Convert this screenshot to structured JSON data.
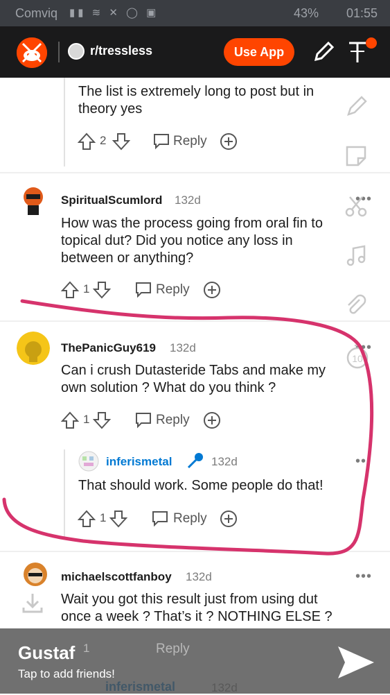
{
  "status_bar": {
    "carrier": "Comviq",
    "battery": "43%",
    "time": "01:55"
  },
  "header": {
    "subreddit": "r/tressless",
    "use_app_label": "Use App"
  },
  "comments": [
    {
      "text_lines": [
        "The list is extremely long to post but in",
        "theory yes"
      ],
      "votes": "2",
      "reply_label": "Reply"
    },
    {
      "author": "SpiritualScumlord",
      "age": "132d",
      "text_lines": [
        "How was the process going from oral fin to",
        "topical dut? Did you notice any loss in",
        "between or anything?"
      ],
      "votes": "1",
      "reply_label": "Reply"
    },
    {
      "author": "ThePanicGuy619",
      "age": "132d",
      "text_lines": [
        "Can i crush Dutasteride Tabs and make my",
        "own solution ? What do you think ?"
      ],
      "votes": "1",
      "reply_label": "Reply"
    },
    {
      "author": "inferismetal",
      "age": "132d",
      "text_lines": [
        "That should work. Some people do that!"
      ],
      "votes": "1",
      "reply_label": "Reply"
    },
    {
      "author": "michaelscottfanboy",
      "age": "132d",
      "text_lines": [
        "Wait you got this result just from using dut",
        "once a week ? That’s it ? NOTHING ELSE ?"
      ],
      "votes": "1",
      "reply_label": "Reply"
    }
  ],
  "snap_overlay": {
    "friend_name": "Gustaf",
    "subtitle": "Tap to add friends!",
    "next_author": "inferismetal",
    "next_age": "132d",
    "timer": "10"
  },
  "colors": {
    "accent": "#ff4500",
    "annotation": "#d6336c",
    "op_blue": "#0079d3"
  }
}
